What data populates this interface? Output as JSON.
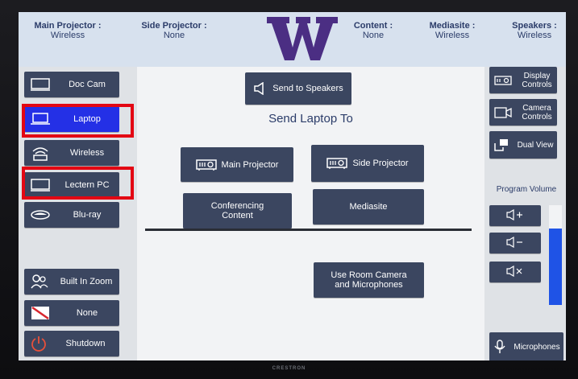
{
  "status": {
    "main_projector": {
      "title": "Main Projector :",
      "value": "Wireless"
    },
    "side_projector": {
      "title": "Side Projector :",
      "value": "None"
    },
    "content": {
      "title": "Content :",
      "value": "None"
    },
    "mediasite": {
      "title": "Mediasite :",
      "value": "Wireless"
    },
    "speakers": {
      "title": "Speakers :",
      "value": "Wireless"
    }
  },
  "logo": {
    "letter": "W",
    "color": "#4b2e83"
  },
  "sources": [
    {
      "label": "Doc Cam",
      "icon": "monitor-icon",
      "active": false
    },
    {
      "label": "Laptop",
      "icon": "laptop-icon",
      "active": true
    },
    {
      "label": "Wireless",
      "icon": "wireless-icon",
      "active": false
    },
    {
      "label": "Lectern PC",
      "icon": "monitor-icon",
      "active": false
    },
    {
      "label": "Blu-ray",
      "icon": "bluray-icon",
      "active": false
    },
    {
      "label": "Built In Zoom",
      "icon": "people-icon",
      "active": false
    },
    {
      "label": "None",
      "icon": "no-source-icon",
      "active": false
    },
    {
      "label": "Shutdown",
      "icon": "power-icon",
      "active": false
    }
  ],
  "center": {
    "send_to_speakers": "Send to Speakers",
    "heading": "Send Laptop To",
    "main_projector": "Main Projector",
    "side_projector": "Side Projector",
    "conferencing_content": "Conferencing Content",
    "mediasite": "Mediasite",
    "use_room_camera": "Use Room Camera and Microphones"
  },
  "right": {
    "display_controls": "Display Controls",
    "camera_controls": "Camera Controls",
    "dual_view": "Dual View",
    "program_volume": "Program Volume",
    "volume_level": 0.77,
    "microphones": "Microphones"
  },
  "brand": "CRESTRON",
  "colors": {
    "active": "#2430e6",
    "button": "#3b4660",
    "highlight": "#e30613",
    "volume_fill": "#1f53e6",
    "text": "#2b3c69"
  }
}
